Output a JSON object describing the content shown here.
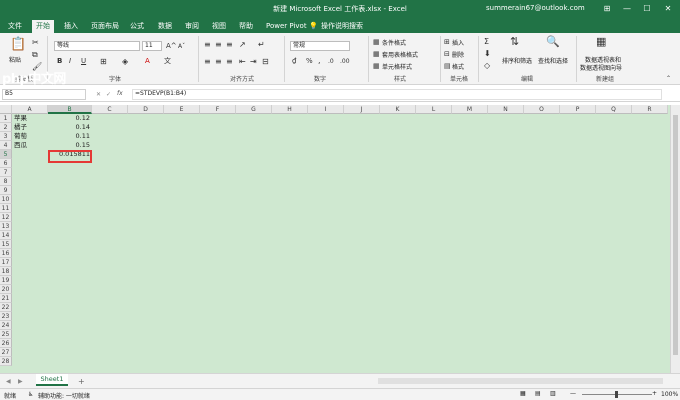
{
  "window": {
    "title": "新建 Microsoft Excel 工作表.xlsx  -  Excel",
    "user": "summerain67@outlook.com",
    "controls": [
      "⊞",
      "—",
      "☐",
      "✕"
    ]
  },
  "tabs": [
    "文件",
    "开始",
    "插入",
    "页面布局",
    "公式",
    "数据",
    "审阅",
    "视图",
    "帮助",
    "Power Pivot",
    "操作说明搜索"
  ],
  "active_tab": "开始",
  "ribbon": {
    "clipboard": {
      "paste": "粘贴",
      "label": "剪贴板"
    },
    "font": {
      "name": "等线",
      "size": "11",
      "label": "字体",
      "bold": "B",
      "italic": "I",
      "underline": "U"
    },
    "alignment": {
      "label": "对齐方式"
    },
    "number": {
      "format": "常规",
      "label": "数字",
      "percent": "%",
      "comma": ","
    },
    "styles": {
      "items": [
        "条件格式",
        "套用表格格式",
        "单元格样式"
      ],
      "label": "样式"
    },
    "cells": {
      "items": [
        "插入",
        "删除",
        "格式"
      ],
      "label": "单元格"
    },
    "editing": {
      "sort": "排序和筛选",
      "find": "查找和选择",
      "label": "编辑"
    },
    "newgroup": {
      "pivot_line1": "数据透视表和",
      "pivot_line2": "数据透视图向导",
      "label": "新建组"
    }
  },
  "formula_bar": {
    "name_box": "B5",
    "fx": "fx",
    "formula": "=STDEVP(B1:B4)"
  },
  "columns": [
    "A",
    "B",
    "C",
    "D",
    "E",
    "F",
    "G",
    "H",
    "I",
    "J",
    "K",
    "L",
    "M",
    "N",
    "O",
    "P",
    "Q",
    "R"
  ],
  "rows": [
    "1",
    "2",
    "3",
    "4",
    "5",
    "6",
    "7",
    "8",
    "9",
    "10",
    "11",
    "12",
    "13",
    "14",
    "15",
    "16",
    "17",
    "18",
    "19",
    "20",
    "21",
    "22",
    "23",
    "24",
    "25",
    "26",
    "27",
    "28"
  ],
  "cells": [
    {
      "row": 1,
      "a": "苹果",
      "b": "0.12"
    },
    {
      "row": 2,
      "a": "橘子",
      "b": "0.14"
    },
    {
      "row": 3,
      "a": "葡萄",
      "b": "0.11"
    },
    {
      "row": 4,
      "a": "西瓜",
      "b": "0.15"
    },
    {
      "row": 5,
      "a": "",
      "b": "0.015811"
    }
  ],
  "sheet": {
    "tab": "Sheet1",
    "add": "+"
  },
  "status": {
    "ready": "就绪",
    "accessibility": "辅助功能: 一切就绪",
    "zoom": "100%"
  },
  "watermark": "php中文网",
  "colors": {
    "accent": "#217346",
    "grid_bg": "#cfe8d0",
    "highlight": "#e53935"
  }
}
